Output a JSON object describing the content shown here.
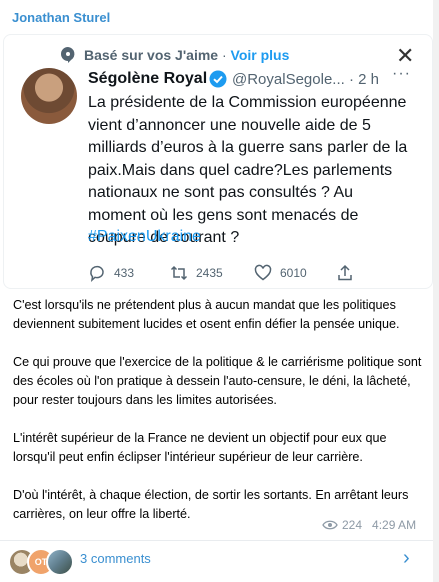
{
  "sender": "Jonathan Sturel",
  "tweet": {
    "context_prefix": "Basé sur vos J'aime",
    "context_separator": "·",
    "context_link": "Voir plus",
    "close_glyph": "✕",
    "author_name": "Ségolène Royal",
    "handle_time": "@RoyalSegole... · 2 h",
    "more_glyph": "···",
    "text": "La présidente de la Commission européenne vient d’annoncer une nouvelle aide de 5 milliards d’euros à la guerre sans parler de la paix.Mais dans quel cadre?Les parlements nationaux ne sont pas consultés ? Au moment où les gens sont menacés de coupure de courant ?",
    "hashtag": "#PaixenUkraine",
    "replies": "433",
    "retweets": "2435",
    "likes": "6010"
  },
  "message": {
    "p1": "C'est lorsqu'ils ne prétendent plus à aucun mandat que les politiques deviennent subitement lucides et osent enfin défier la pensée unique.",
    "p2": "Ce qui prouve que l'exercice de la politique & le carriérisme politique sont des écoles où l'on pratique à dessein l'auto-censure, le déni, la lâcheté, pour rester toujours dans les limites autorisées.",
    "p3": "L'intérêt supérieur de la France ne devient un objectif pour eux que lorsqu'il peut enfin éclipser l'intérieur supérieur de leur carrière.",
    "p4": "D'où l'intérêt, à chaque élection, de sortir les sortants. En arrêtant leurs carrières, on leur offre la liberté."
  },
  "meta": {
    "views": "224",
    "time": "4:29 AM"
  },
  "comments": {
    "label": "3 comments",
    "avatar2_initials": "OT"
  },
  "colors": {
    "link": "#3a8fd0",
    "twitter_blue": "#1d9bf0",
    "muted": "#536471"
  }
}
